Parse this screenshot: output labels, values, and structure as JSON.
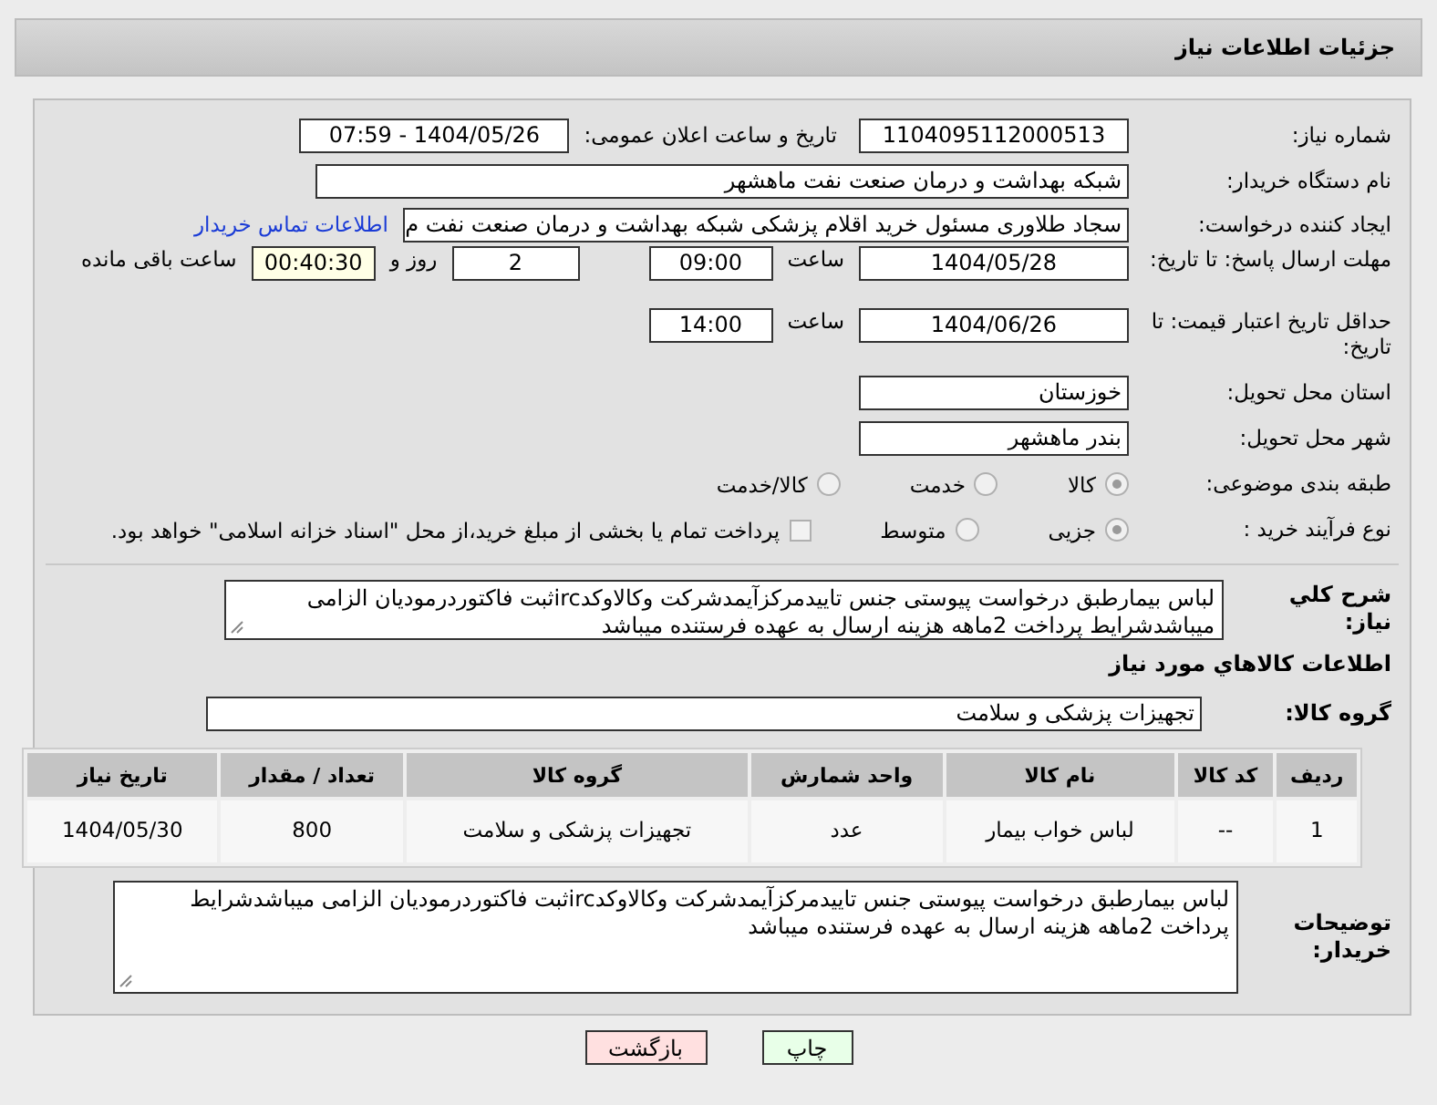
{
  "header": {
    "title": "جزئیات اطلاعات نیاز"
  },
  "need_number": {
    "label": "شماره نیاز:",
    "value": "1104095112000513"
  },
  "announce": {
    "label": "تاریخ و ساعت اعلان عمومی:",
    "value": "1404/05/26 - 07:59"
  },
  "buyer_org": {
    "label": "نام دستگاه خریدار:",
    "value": "شبکه بهداشت و درمان صنعت نفت ماهشهر"
  },
  "requester": {
    "label": "ایجاد کننده درخواست:",
    "value": "سجاد طلاوری مسئول خرید اقلام پزشکی شبکه بهداشت و درمان صنعت نفت م",
    "link": "اطلاعات تماس خریدار"
  },
  "reply_deadline": {
    "label": "مهلت ارسال پاسخ: تا تاریخ:",
    "date": "1404/05/28",
    "time_label": "ساعت",
    "time": "09:00",
    "days": "2",
    "days_label": "روز و",
    "remaining": "00:40:30",
    "remaining_label": "ساعت باقی مانده"
  },
  "price_validity": {
    "label": "حداقل تاریخ اعتبار قیمت: تا تاریخ:",
    "date": "1404/06/26",
    "time_label": "ساعت",
    "time": "14:00"
  },
  "province": {
    "label": "استان محل تحویل:",
    "value": "خوزستان"
  },
  "city": {
    "label": "شهر محل تحویل:",
    "value": "بندر ماهشهر"
  },
  "category": {
    "label": "طبقه بندی موضوعی:",
    "options": [
      {
        "label": "کالا",
        "selected": true
      },
      {
        "label": "خدمت",
        "selected": false
      },
      {
        "label": "کالا/خدمت",
        "selected": false
      }
    ]
  },
  "process": {
    "label": "نوع فرآیند خرید :",
    "options": [
      {
        "label": "جزیی",
        "selected": true
      },
      {
        "label": "متوسط",
        "selected": false
      }
    ],
    "treasury": {
      "label": "پرداخت تمام یا بخشی از مبلغ خرید،از محل \"اسناد خزانه اسلامی\" خواهد بود.",
      "checked": false
    }
  },
  "description": {
    "label": "شرح كلي نياز:",
    "value": "لباس بیمارطبق درخواست پیوستی جنس تاییدمرکزآیمدشرکت وکالاوکدircثبت فاکتوردرمودیان الزامی میباشدشرایط پرداخت 2ماهه هزینه ارسال به عهده فرستنده میباشد"
  },
  "goods_title": "اطلاعات كالاهاي مورد نياز",
  "goods_group": {
    "label": "گروه کالا:",
    "value": "تجهیزات پزشکی و سلامت"
  },
  "table": {
    "columns": [
      "ردیف",
      "کد کالا",
      "نام کالا",
      "واحد شمارش",
      "گروه کالا",
      "تعداد / مقدار",
      "تاریخ نیاز"
    ],
    "rows": [
      [
        "1",
        "--",
        "لباس خواب بیمار",
        "عدد",
        "تجهیزات پزشکی و سلامت",
        "800",
        "1404/05/30"
      ]
    ]
  },
  "buyer_notes": {
    "label": "توضیحات خریدار:",
    "value": "لباس بیمارطبق درخواست پیوستی جنس تاییدمرکزآیمدشرکت وکالاوکدircثبت فاکتوردرمودیان الزامی میباشدشرایط پرداخت 2ماهه هزینه ارسال به عهده فرستنده میباشد"
  },
  "buttons": [
    {
      "label": "چاپ",
      "kind": "print"
    },
    {
      "label": "بازگشت",
      "kind": "back"
    }
  ]
}
